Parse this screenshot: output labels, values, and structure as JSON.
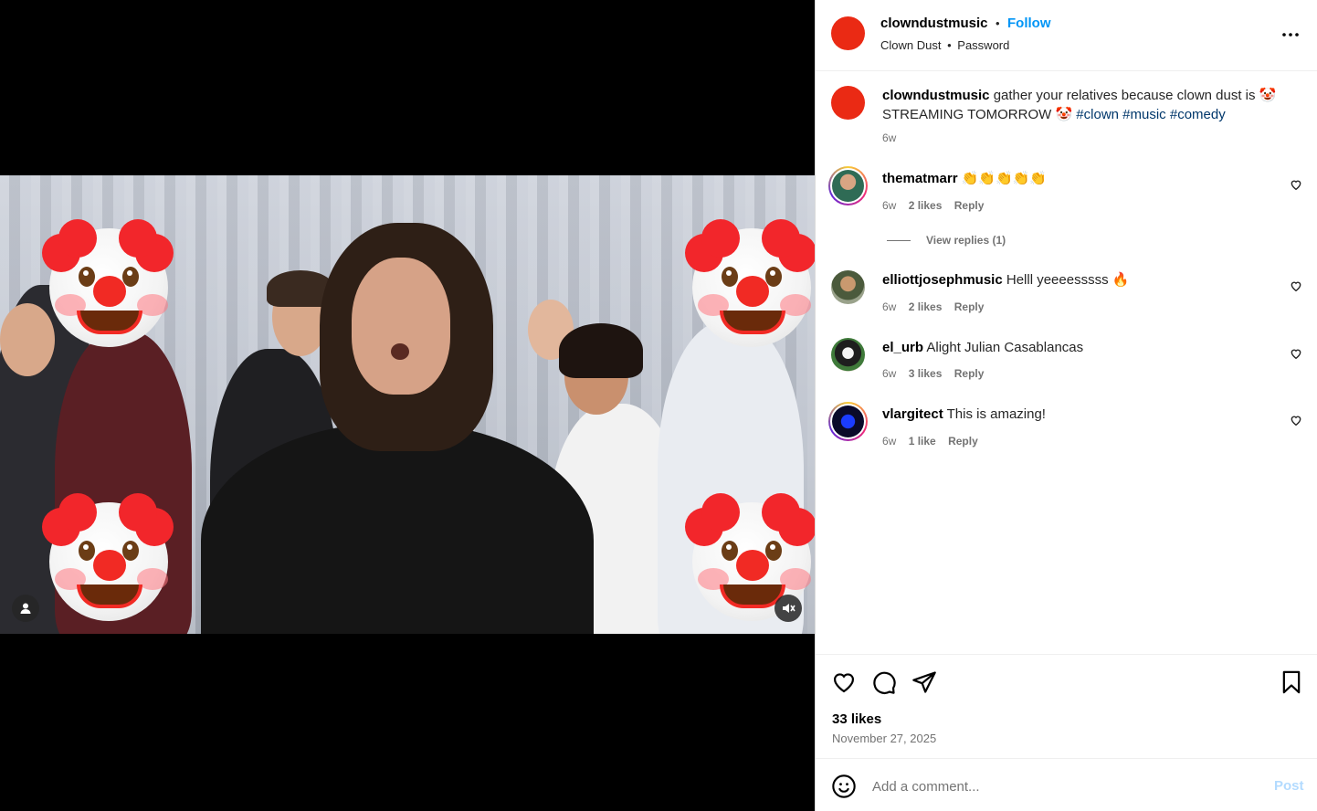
{
  "post": {
    "username": "clowndustmusic",
    "follow_label": "Follow",
    "separator": "•",
    "audio_title": "Clown Dust",
    "audio_sub": "Password",
    "caption": {
      "text": "gather your relatives because clown dust is 🤡 STREAMING TOMORROW 🤡",
      "hashtags": [
        "#clown",
        "#music",
        "#comedy"
      ],
      "time": "6w"
    }
  },
  "comments": [
    {
      "username": "thematmarr",
      "text": "👏👏👏👏👏",
      "time": "6w",
      "likes": "2 likes",
      "reply": "Reply",
      "view_replies": "View replies (1)"
    },
    {
      "username": "elliottjosephmusic",
      "text": "Helll yeeeesssss 🔥",
      "time": "6w",
      "likes": "2 likes",
      "reply": "Reply"
    },
    {
      "username": "el_urb",
      "text": "Alight Julian Casablancas",
      "time": "6w",
      "likes": "3 likes",
      "reply": "Reply"
    },
    {
      "username": "vlargitect",
      "text": "This is amazing!",
      "time": "6w",
      "likes": "1 like",
      "reply": "Reply"
    }
  ],
  "footer": {
    "likes": "33 likes",
    "date": "November 27, 2025",
    "comment_placeholder": "Add a comment...",
    "post_label": "Post"
  },
  "icons": {
    "more": "more-options-icon",
    "like": "heart-icon",
    "comment": "comment-icon",
    "share": "share-icon",
    "save": "bookmark-icon",
    "emoji": "emoji-icon",
    "user_tag": "user-tag-icon",
    "mute": "muted-speaker-icon"
  },
  "colors": {
    "accent": "#0095f6",
    "avatar_red": "#ea2a14",
    "hashtag": "#00376b"
  }
}
